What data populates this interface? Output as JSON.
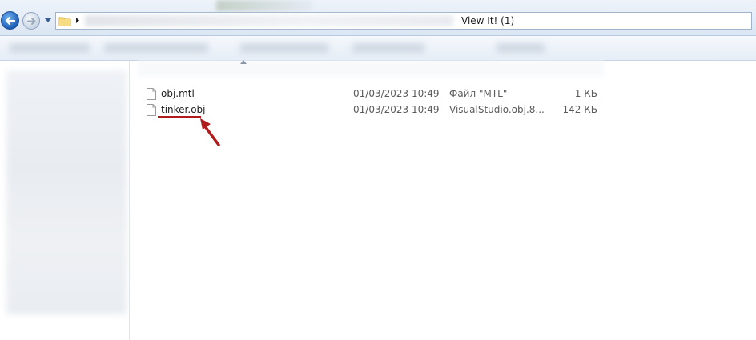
{
  "window": {
    "title": "View It! (1)"
  },
  "files": [
    {
      "name": "obj.mtl",
      "date": "01/03/2023 10:49",
      "type": "Файл \"MTL\"",
      "size": "1 КБ",
      "icon": "file-icon"
    },
    {
      "name": "tinker.obj",
      "date": "01/03/2023 10:49",
      "type": "VisualStudio.obj.8...",
      "size": "142 КБ",
      "icon": "file-icon",
      "highlighted": true
    }
  ],
  "colors": {
    "annotation": "#b01c1c",
    "nav_back": "#1d5fb8"
  }
}
